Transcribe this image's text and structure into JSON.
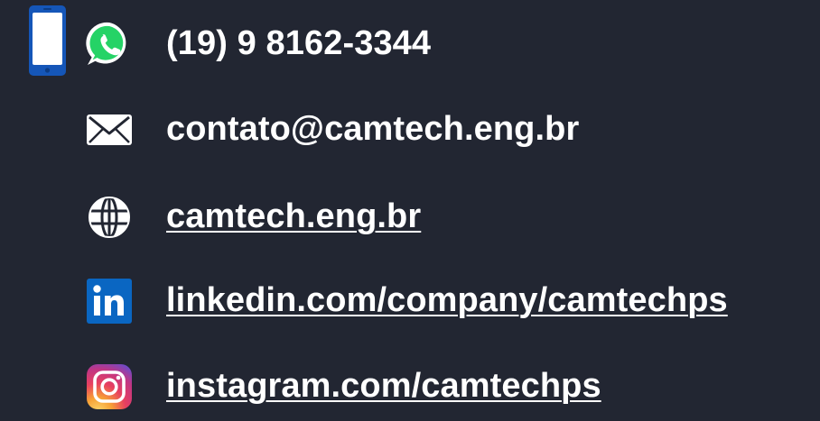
{
  "contacts": {
    "phone": "(19) 9 8162-3344",
    "email": "contato@camtech.eng.br",
    "website": "camtech.eng.br",
    "linkedin": "linkedin.com/company/camtechps",
    "instagram": "instagram.com/camtechps"
  },
  "icons": {
    "phone": "smartphone-icon",
    "whatsapp": "whatsapp-icon",
    "email": "envelope-icon",
    "website": "globe-icon",
    "linkedin": "linkedin-icon",
    "instagram": "instagram-icon"
  },
  "colors": {
    "background": "#222632",
    "text": "#ffffff",
    "whatsapp": "#25d366",
    "linkedin": "#0a66c2",
    "phone": "#1556b8"
  }
}
